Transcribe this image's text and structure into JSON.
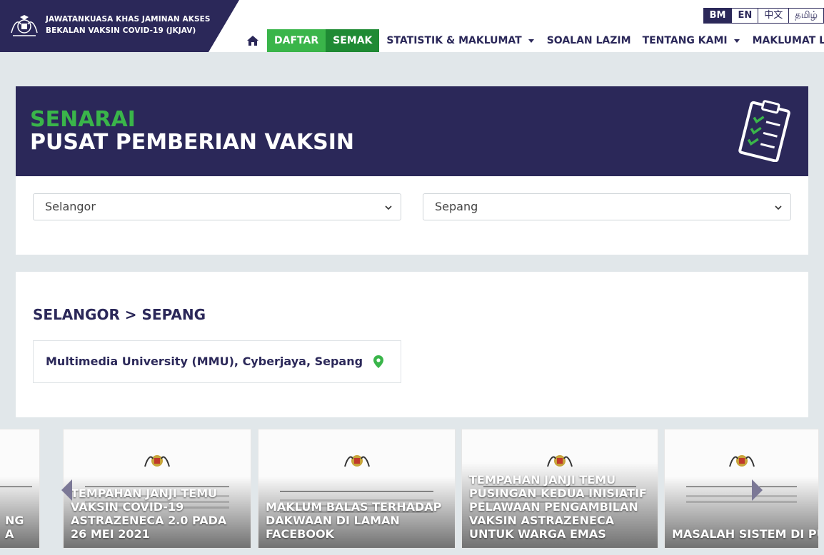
{
  "header": {
    "brand_line1": "JAWATANKUASA KHAS JAMINAN AKSES",
    "brand_line2": "BEKALAN VAKSIN COVID-19 (JKJAV)",
    "languages": [
      "BM",
      "EN",
      "中文",
      "தமிழ்"
    ],
    "active_language": "BM",
    "nav": {
      "home_icon": "home-icon",
      "daftar": "DAFTAR",
      "semak": "SEMAK",
      "statistik": "STATISTIK & MAKLUMAT",
      "soalan": "SOALAN LAZIM",
      "tentang": "TENTANG KAMI",
      "maklumat": "MAKLUMAT LAIN"
    }
  },
  "banner": {
    "title_line1": "SENARAI",
    "title_line2": "PUSAT PEMBERIAN VAKSIN",
    "icon": "clipboard-checklist-icon"
  },
  "filters": {
    "state": "Selangor",
    "district": "Sepang"
  },
  "results": {
    "breadcrumb": "SELANGOR > SEPANG",
    "locations": [
      {
        "name": "Multimedia University (MMU), Cyberjaya, Sepang",
        "icon": "map-pin-icon"
      }
    ]
  },
  "carousel": {
    "cards": [
      {
        "caption": "NG\nA"
      },
      {
        "caption": "TEMPAHAN JANJI TEMU VAKSIN COVID-19 ASTRAZENECA 2.0 PADA 26 MEI 2021"
      },
      {
        "caption": "MAKLUM BALAS TERHADAP DAKWAAN DI LAMAN FACEBOOK"
      },
      {
        "caption": "TEMPAHAN JANJI TEMU PUSINGAN KEDUA INISIATIF PELAWAAN PENGAMBILAN VAKSIN ASTRAZENECA UNTUK WARGA EMAS"
      },
      {
        "caption": "MASALAH SISTEM DI PUSAT PEMBERIAN VAKSIN (PPV)"
      }
    ]
  },
  "colors": {
    "navy": "#2b2859",
    "green": "#3ab54a",
    "dark_green": "#1f8a34",
    "page_bg": "#e1e7ea"
  }
}
